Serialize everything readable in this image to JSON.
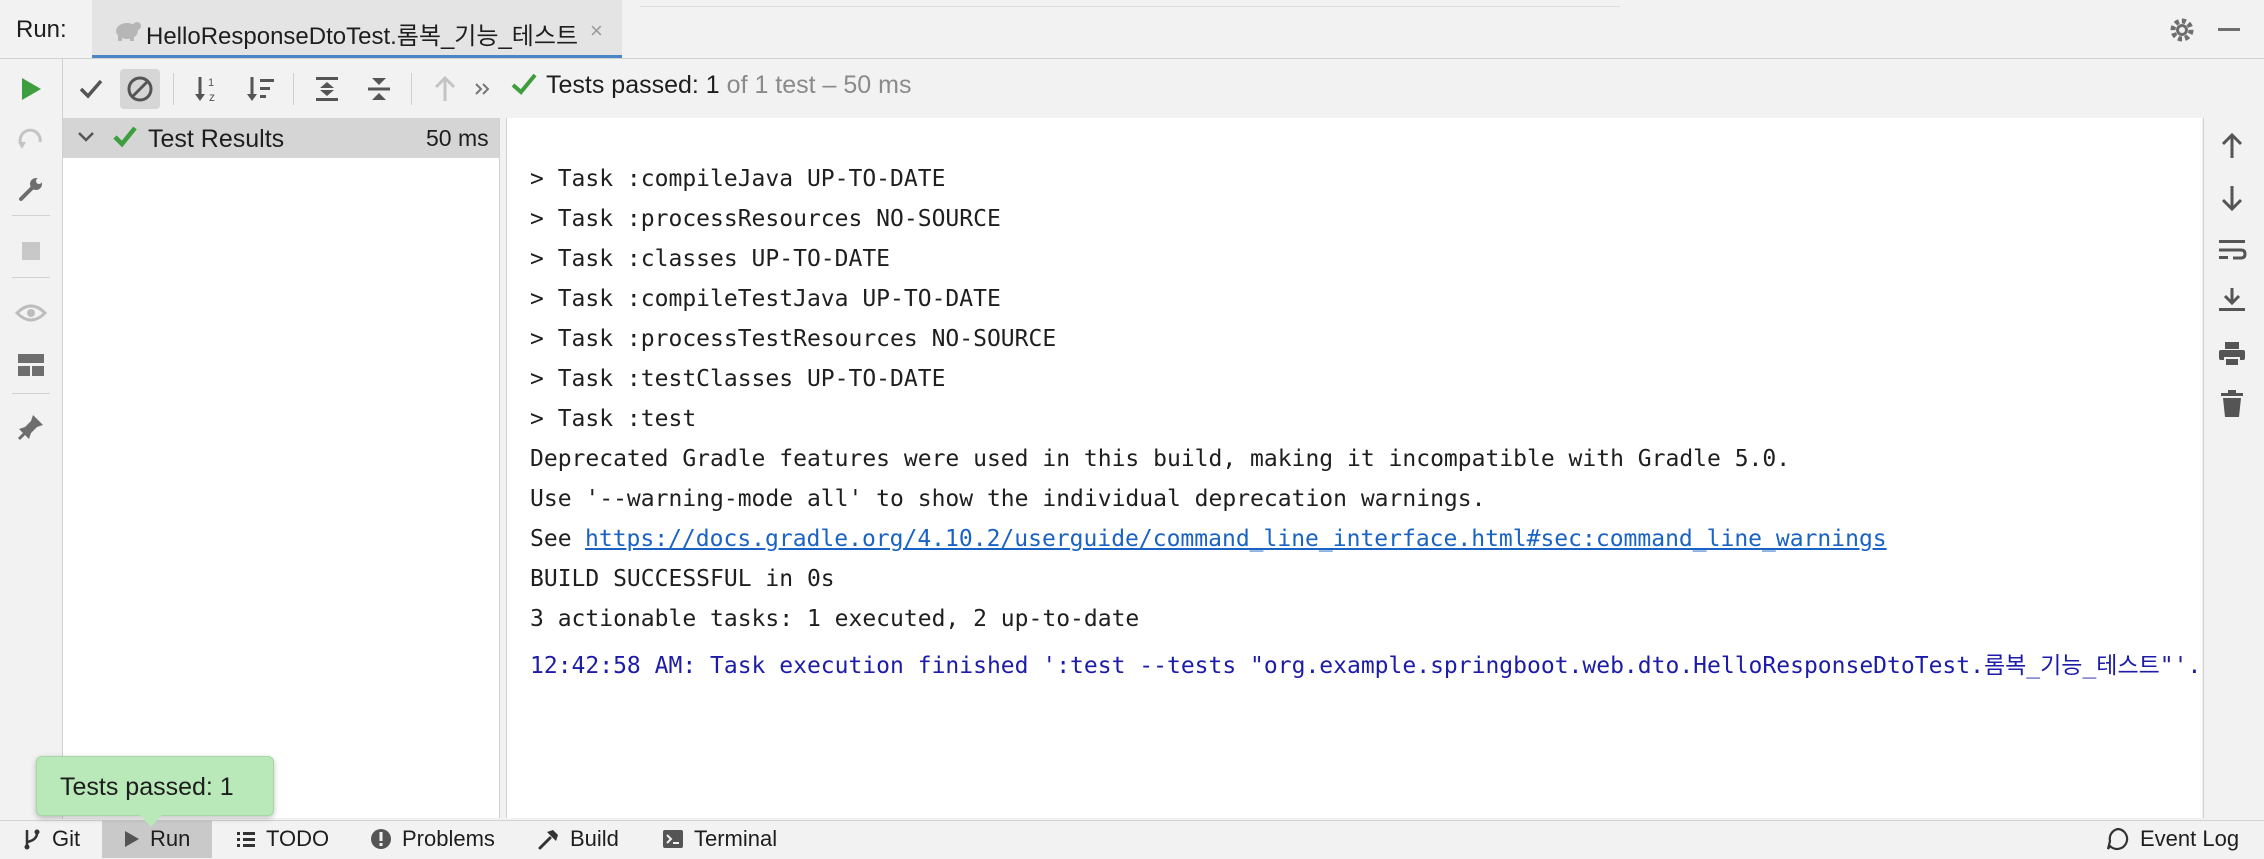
{
  "header": {
    "run_label": "Run:",
    "tab_title": "HelloResponseDtoTest.롬복_기능_테스트",
    "tab_close": "×"
  },
  "toolbar": {
    "status_bold": "Tests passed: 1",
    "status_rest": " of 1 test – 50 ms"
  },
  "tree": {
    "root_label": "Test Results",
    "root_time": "50 ms"
  },
  "console": {
    "lines": [
      "> Task :compileJava UP-TO-DATE",
      "> Task :processResources NO-SOURCE",
      "> Task :classes UP-TO-DATE",
      "> Task :compileTestJava UP-TO-DATE",
      "> Task :processTestResources NO-SOURCE",
      "> Task :testClasses UP-TO-DATE",
      "> Task :test",
      "Deprecated Gradle features were used in this build, making it incompatible with Gradle 5.0.",
      "Use '--warning-mode all' to show the individual deprecation warnings.",
      "See ",
      "BUILD SUCCESSFUL in 0s",
      "3 actionable tasks: 1 executed, 2 up-to-date",
      "12:42:58 AM: Task execution finished ':test --tests \"org.example.springboot.web.dto.HelloResponseDtoTest.롬복_기능_테스트\"'."
    ],
    "link": "https://docs.gradle.org/4.10.2/userguide/command_line_interface.html#sec:command_line_warnings"
  },
  "tooltip": {
    "text": "Tests passed: 1"
  },
  "bottom_bar": {
    "git": "Git",
    "run": "Run",
    "todo": "TODO",
    "problems": "Problems",
    "build": "Build",
    "terminal": "Terminal",
    "event_log": "Event Log"
  },
  "colors": {
    "accent_green": "#3c9e3c",
    "link_blue": "#1a63c4",
    "system_text": "#1c1ca8",
    "tooltip_bg": "#b9e8b9"
  }
}
